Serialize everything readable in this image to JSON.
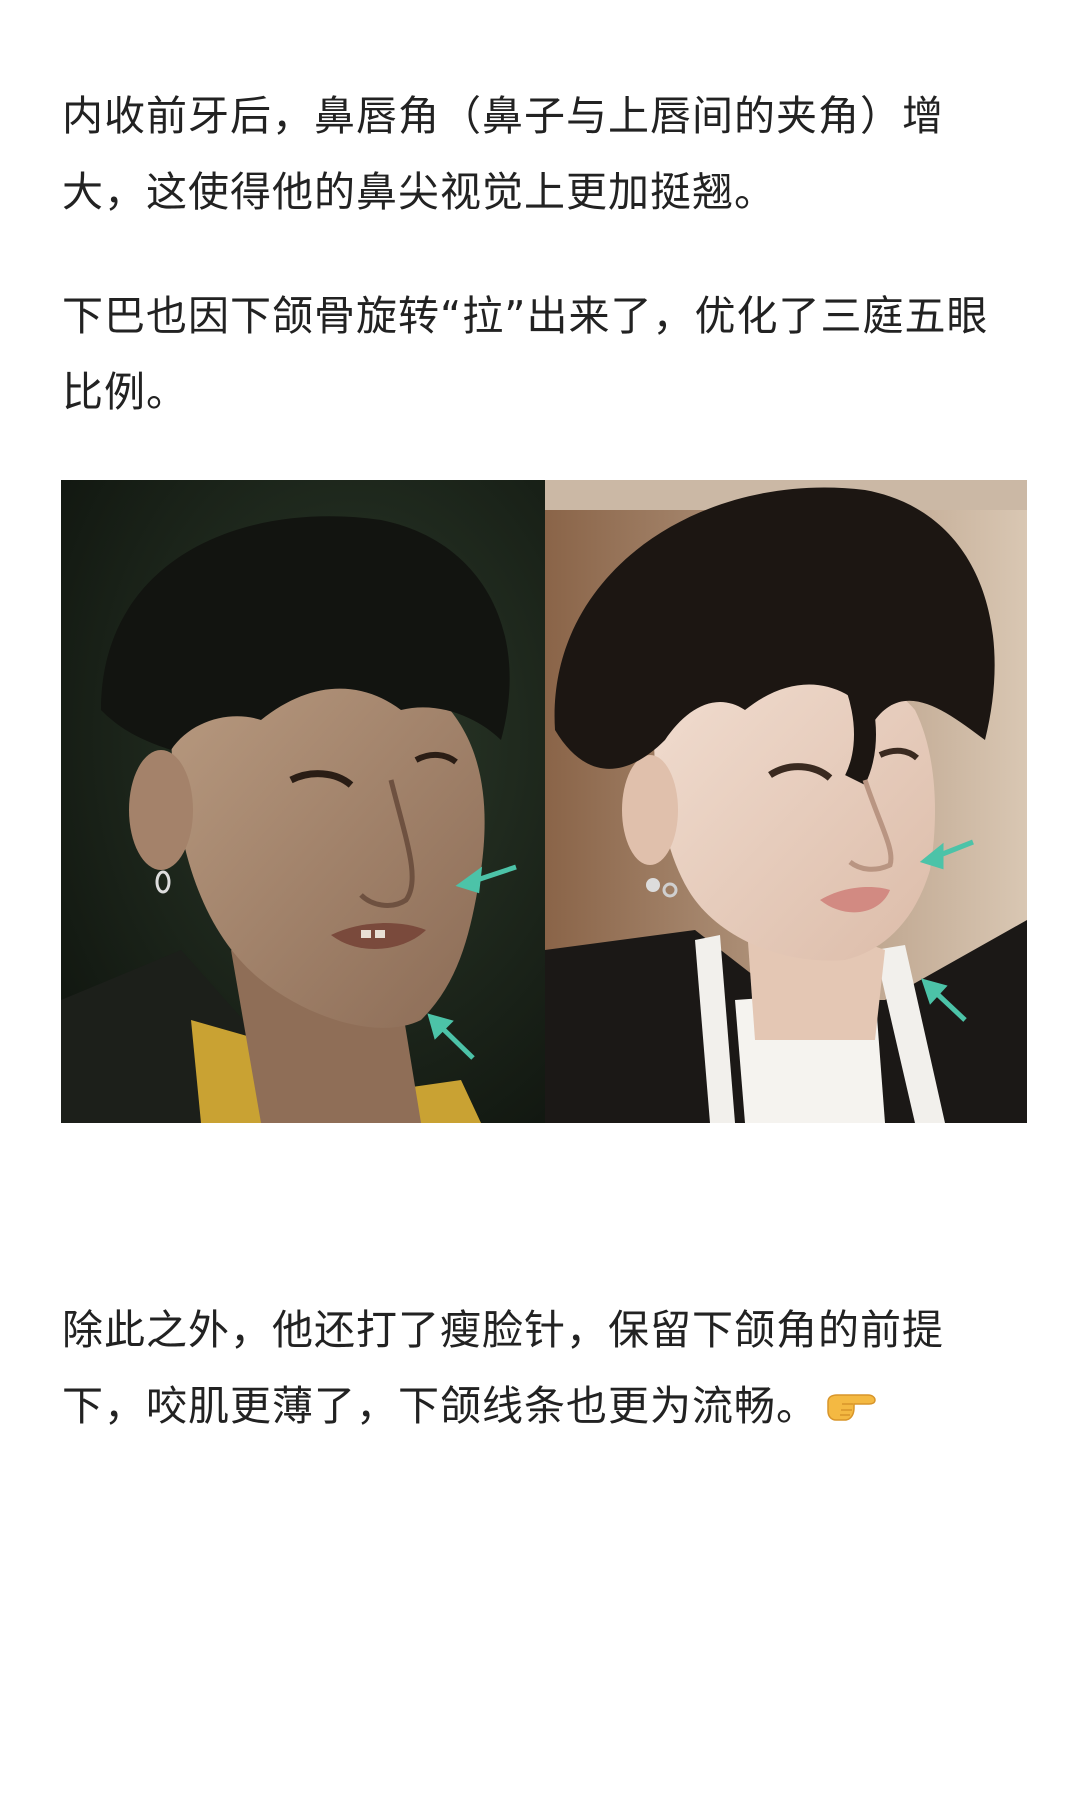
{
  "article": {
    "paragraphs": [
      "内收前牙后，鼻唇角（鼻子与上唇间的夹角）增大，这使得他的鼻尖视觉上更加挺翘。",
      "下巴也因下颌骨旋转“拉”出来了，优化了三庭五眼比例。",
      "除此之外，他还打了瘦脸针，保留下颌角的前提下，咬肌更薄了，下颌线条也更为流畅。"
    ],
    "emoji_icon": "pointing-right-hand-icon",
    "comparison_image": {
      "left": "before-photo",
      "right": "after-photo",
      "arrow_color": "#4cc3a8"
    }
  }
}
